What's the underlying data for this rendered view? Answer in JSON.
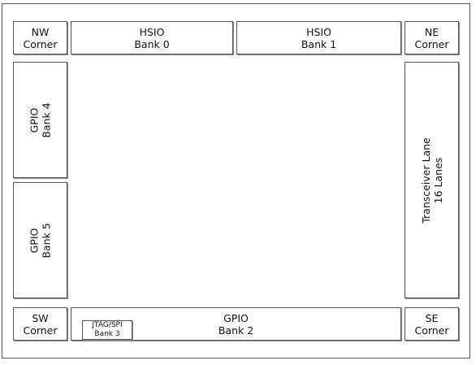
{
  "nw_corner": [
    "NW",
    "Corner"
  ],
  "ne_corner": [
    "NE",
    "Corner"
  ],
  "sw_corner": [
    "SW",
    "Corner"
  ],
  "se_corner": [
    "SE",
    "Corner"
  ],
  "hsio_bank0": [
    "HSIO",
    "Bank 0"
  ],
  "hsio_bank1": [
    "HSIO",
    "Bank 1"
  ],
  "gpio_bank4": [
    "GPIO",
    "Bank 4"
  ],
  "gpio_bank5": [
    "GPIO",
    "Bank 5"
  ],
  "gpio_bank2": [
    "GPIO",
    "Bank 2"
  ],
  "jtag_spi_bank3": [
    "JTAG/SPI",
    "Bank 3"
  ],
  "transceiver": [
    "Transceiver Lane",
    "16 Lanes"
  ]
}
